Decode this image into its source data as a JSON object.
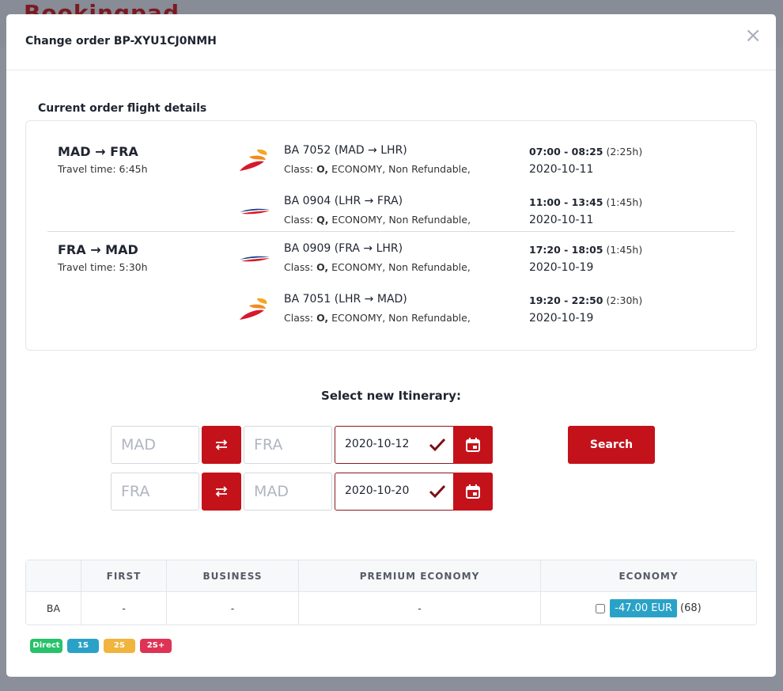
{
  "background": {
    "logo_text": "Bookingpad"
  },
  "modal": {
    "title": "Change order BP-XYU1CJ0NMH",
    "close_glyph": "×"
  },
  "current": {
    "title": "Current order flight details",
    "routes": [
      {
        "title": "MAD → FRA",
        "travel_time": "Travel time: 6:45h",
        "segments": [
          {
            "airline_logo": "iberia-logo",
            "flight": "BA 7052 (MAD → LHR)",
            "class_prefix": "Class: ",
            "class_code": "O,",
            "class_rest": " ECONOMY, Non Refundable,",
            "time_range": "07:00 - 08:25",
            "duration": " (2:25h)",
            "date": "2020-10-11"
          },
          {
            "airline_logo": "british-airways-logo",
            "flight": "BA 0904 (LHR → FRA)",
            "class_prefix": "Class: ",
            "class_code": "Q,",
            "class_rest": " ECONOMY, Non Refundable,",
            "time_range": "11:00 - 13:45",
            "duration": " (1:45h)",
            "date": "2020-10-11"
          }
        ]
      },
      {
        "title": "FRA → MAD",
        "travel_time": "Travel time: 5:30h",
        "segments": [
          {
            "airline_logo": "british-airways-logo",
            "flight": "BA 0909 (FRA → LHR)",
            "class_prefix": "Class: ",
            "class_code": "O,",
            "class_rest": " ECONOMY, Non Refundable,",
            "time_range": "17:20 - 18:05",
            "duration": " (1:45h)",
            "date": "2020-10-19"
          },
          {
            "airline_logo": "iberia-logo",
            "flight": "BA 7051 (LHR → MAD)",
            "class_prefix": "Class: ",
            "class_code": "O,",
            "class_rest": " ECONOMY, Non Refundable,",
            "time_range": "19:20 - 22:50",
            "duration": " (2:30h)",
            "date": "2020-10-19"
          }
        ]
      }
    ]
  },
  "itinerary": {
    "title": "Select new Itinerary:",
    "rows": [
      {
        "from": "MAD",
        "to": "FRA",
        "date": "2020-10-12"
      },
      {
        "from": "FRA",
        "to": "MAD",
        "date": "2020-10-20"
      }
    ],
    "search_label": "Search",
    "colors": {
      "accent": "#c4121b",
      "date_border": "#8a1a1f",
      "check": "#7a1016"
    }
  },
  "prices": {
    "headers": [
      "",
      "FIRST",
      "BUSINESS",
      "PREMIUM ECONOMY",
      "ECONOMY"
    ],
    "rows": [
      {
        "airline": "BA",
        "first": "-",
        "business": "-",
        "premium": "-",
        "economy_price": "-47.00 EUR",
        "economy_count": "(68)"
      }
    ],
    "badge_color": "#2aa2c8"
  },
  "legend": [
    {
      "label": "Direct",
      "color": "#27c26a"
    },
    {
      "label": "1S",
      "color": "#2aa2c8"
    },
    {
      "label": "2S",
      "color": "#f1b43c"
    },
    {
      "label": "2S+",
      "color": "#dd3355"
    }
  ]
}
